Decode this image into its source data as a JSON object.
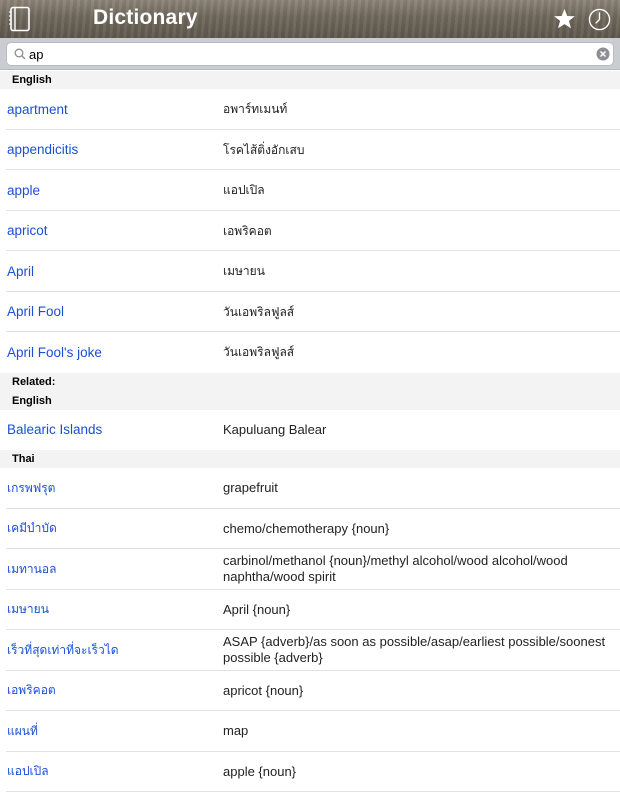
{
  "header": {
    "title": "Dictionary"
  },
  "search": {
    "value": "ap",
    "placeholder": ""
  },
  "sections": {
    "english": {
      "label": "English",
      "rows": [
        {
          "term": "apartment",
          "translation": "อพาร์ทเมนท์"
        },
        {
          "term": "appendicitis",
          "translation": "โรคไส้ติ่งอักเสบ"
        },
        {
          "term": "apple",
          "translation": "แอปเปิล"
        },
        {
          "term": "apricot",
          "translation": "เอพริคอต"
        },
        {
          "term": "April",
          "translation": "เมษายน"
        },
        {
          "term": "April Fool",
          "translation": "วันเอพริลฟูลส์"
        },
        {
          "term": "April Fool's joke",
          "translation": "วันเอพริลฟูลส์"
        }
      ]
    },
    "related": {
      "label": "Related:",
      "english_label": "English",
      "english_rows": [
        {
          "term": "Balearic Islands",
          "translation": "Kapuluang Balear"
        }
      ],
      "thai_label": "Thai",
      "thai_rows": [
        {
          "term": "เกรพฟรุต",
          "translation": "grapefruit"
        },
        {
          "term": "เคมีบำบัด",
          "translation": "chemo/chemotherapy {noun}"
        },
        {
          "term": "เมทานอล",
          "translation": "carbinol/methanol {noun}/methyl alcohol/wood alcohol/wood naphtha/wood spirit"
        },
        {
          "term": "เมษายน",
          "translation": "April {noun}"
        },
        {
          "term": "เร็วที่สุดเท่าที่จะเร็วได",
          "translation": "ASAP {adverb}/as soon as possible/asap/earliest possible/soonest possible {adverb}"
        },
        {
          "term": "เอพริคอต",
          "translation": "apricot {noun}"
        },
        {
          "term": "แผนที่",
          "translation": "map"
        },
        {
          "term": "แอปเปิล",
          "translation": "apple {noun}"
        }
      ]
    }
  },
  "icons": {
    "left": "book-icon",
    "favorites": "star-icon",
    "history": "clock-icon",
    "search": "search-icon",
    "clear": "clear-icon"
  },
  "colors": {
    "link": "#1a4fd6",
    "header_bg": "#f3f3f3"
  }
}
